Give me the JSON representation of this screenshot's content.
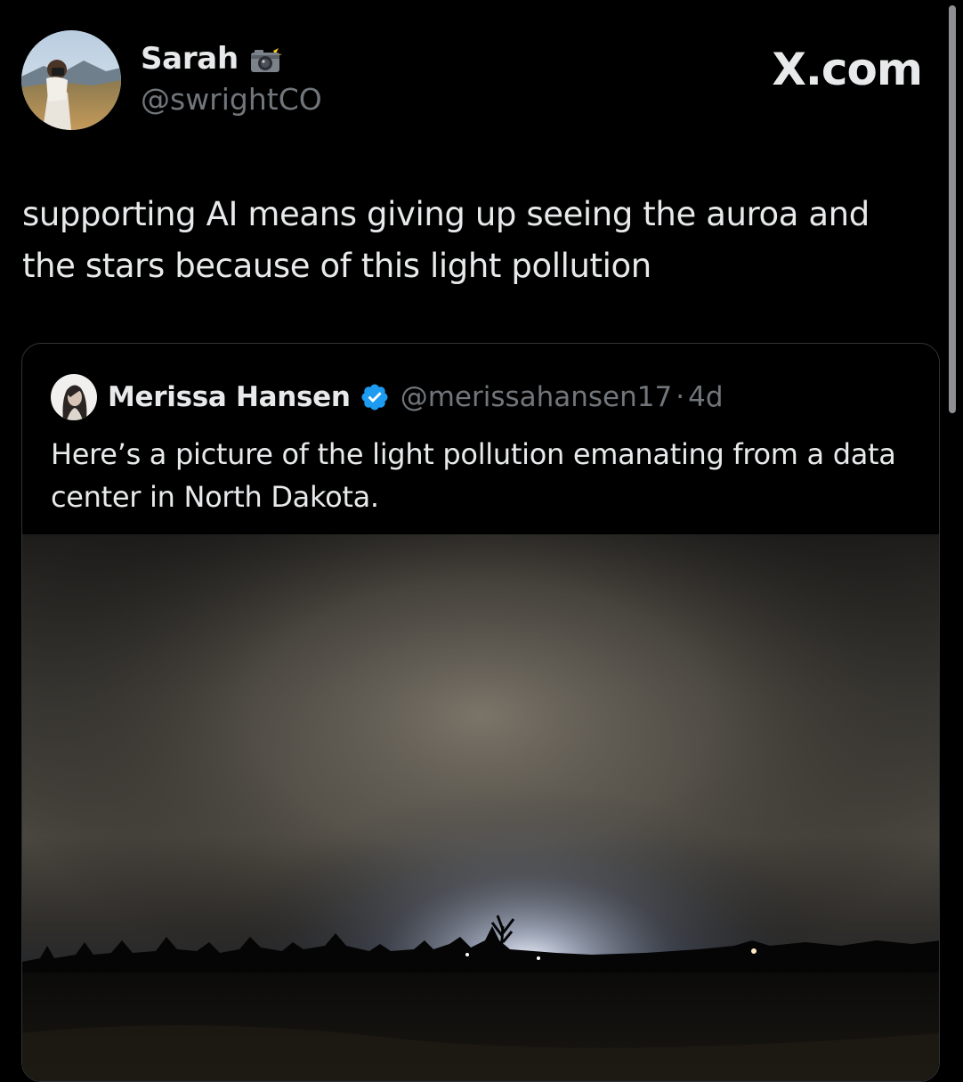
{
  "brand": "X.com",
  "tweet": {
    "author_name": "Sarah",
    "author_emoji": "camera-with-flash",
    "author_handle": "@swrightCO",
    "text": "supporting AI means giving up seeing the auroa and the stars because of this light pollution"
  },
  "quoted_tweet": {
    "author_name": "Merissa Hansen",
    "verified": true,
    "author_handle": "@merissahansen17",
    "separator": "·",
    "time": "4d",
    "text": "Here’s a picture of the light pollution emanating from a data center in North Dakota."
  },
  "colors": {
    "background": "#000000",
    "text_primary": "#e7e9ea",
    "text_secondary": "#71767b",
    "verified_blue": "#1d9bf0",
    "card_border": "#2f3336"
  }
}
